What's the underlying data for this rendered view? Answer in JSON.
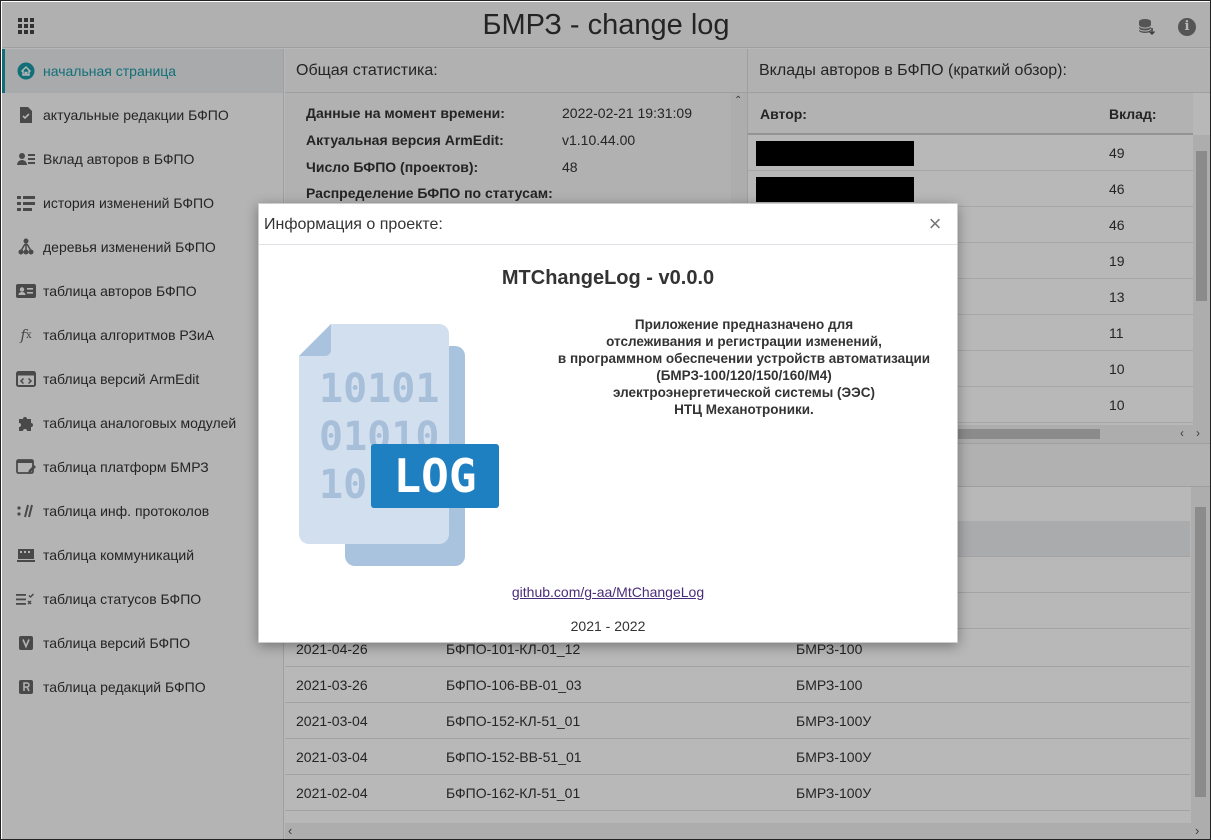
{
  "header": {
    "title": "БМРЗ - change log",
    "apps_icon": "apps-grid-icon",
    "db_icon": "database-download-icon",
    "info_icon": "info-icon"
  },
  "sidebar": {
    "items": [
      {
        "label": "начальная страница",
        "icon": "home-icon",
        "active": true
      },
      {
        "label": "актуальные редакции БФПО",
        "icon": "file-check-icon"
      },
      {
        "label": "Вклад авторов в БФПО",
        "icon": "user-list-icon"
      },
      {
        "label": "история изменений БФПО",
        "icon": "list-icon"
      },
      {
        "label": "деревья изменений БФПО",
        "icon": "tree-icon"
      },
      {
        "label": "таблица авторов БФПО",
        "icon": "id-card-icon"
      },
      {
        "label": "таблица алгоритмов РЗиА",
        "icon": "function-icon"
      },
      {
        "label": "таблица версий ArmEdit",
        "icon": "code-window-icon"
      },
      {
        "label": "таблица аналоговых модулей",
        "icon": "puzzle-icon"
      },
      {
        "label": "таблица платформ БМРЗ",
        "icon": "window-edit-icon"
      },
      {
        "label": "таблица инф. протоколов",
        "icon": "protocol-icon"
      },
      {
        "label": "таблица коммуникаций",
        "icon": "network-icon"
      },
      {
        "label": "таблица статусов БФПО",
        "icon": "status-list-icon"
      },
      {
        "label": "таблица версий БФПО",
        "icon": "v-badge-icon"
      },
      {
        "label": "таблица редакций БФПО",
        "icon": "r-badge-icon"
      }
    ]
  },
  "stats": {
    "heading": "Общая статистика:",
    "rows": [
      {
        "label": "Данные на момент времени:",
        "value": "2022-02-21 19:31:09"
      },
      {
        "label": "Актуальная версия ArmEdit:",
        "value": "v1.10.44.00"
      },
      {
        "label": "Число БФПО (проектов):",
        "value": "48"
      },
      {
        "label": "Распределение БФПО по статусам:",
        "value": ""
      }
    ]
  },
  "authors": {
    "heading": "Вклады авторов в БФПО (краткий обзор):",
    "col_author": "Автор:",
    "col_contrib": "Вклад:",
    "values": [
      "49",
      "46",
      "46",
      "19",
      "13",
      "11",
      "10",
      "10"
    ]
  },
  "changes": {
    "rows": [
      {
        "date": "2021-04-26",
        "name": "БФПО-101-КЛ-01_12",
        "platform": "БМРЗ-100"
      },
      {
        "date": "2021-03-26",
        "name": "БФПО-106-ВВ-01_03",
        "platform": "БМРЗ-100"
      },
      {
        "date": "2021-03-04",
        "name": "БФПО-152-КЛ-51_01",
        "platform": "БМРЗ-100У"
      },
      {
        "date": "2021-03-04",
        "name": "БФПО-152-ВВ-51_01",
        "platform": "БМРЗ-100У"
      },
      {
        "date": "2021-02-04",
        "name": "БФПО-162-КЛ-51_01",
        "platform": "БМРЗ-100У"
      }
    ]
  },
  "modal": {
    "title": "Информация о проекте:",
    "close_icon": "close-icon",
    "app_name": "MTChangeLog - v0.0.0",
    "description": [
      "Приложение предназначено для",
      "отслеживания и регистрации изменений,",
      "в программном обеспечении устройств автоматизации",
      "(БМРЗ-100/120/150/160/М4)",
      "электроэнергетической системы (ЭЭС)",
      "НТЦ Механотроники."
    ],
    "link": "github.com/g-aa/MtChangeLog",
    "years": "2021 - 2022",
    "logo_text": "LOG",
    "logo_binary": [
      "10101",
      "01010",
      "10"
    ]
  },
  "colors": {
    "accent": "#1a9aa6",
    "logo_blue": "#1e7fc1",
    "logo_paper": "#c9d8ea"
  }
}
